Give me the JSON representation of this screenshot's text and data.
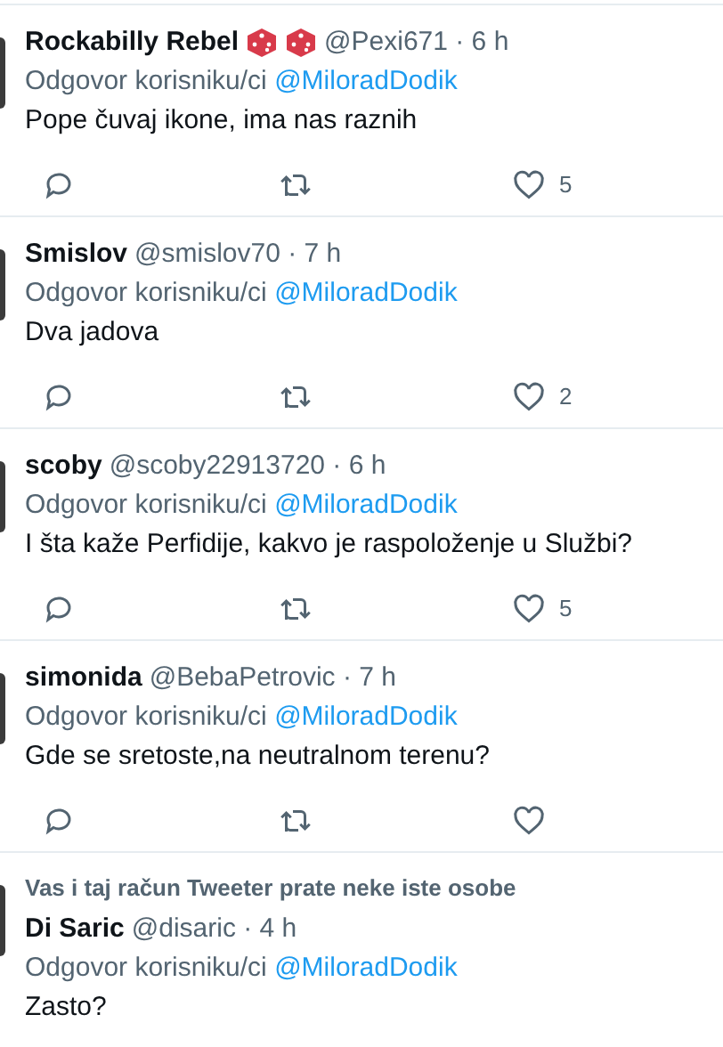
{
  "replies": [
    {
      "name": "Rockabilly Rebel",
      "name_icons": [
        {
          "kind": "dice"
        },
        {
          "kind": "dice"
        }
      ],
      "meta": "@Pexi671 · 6 h",
      "reply_prefix": "Odgovor korisniku/ci",
      "reply_to": "@MiloradDodik",
      "text": "Pope čuvaj ikone, ima nas raznih",
      "actions_shown": true,
      "likes": "5"
    },
    {
      "name": "Smislov",
      "meta": "@smislov70 · 7 h",
      "reply_prefix": "Odgovor korisniku/ci",
      "reply_to": "@MiloradDodik",
      "text": "Dva jadova",
      "actions_shown": true,
      "likes": "2"
    },
    {
      "name": "scoby",
      "meta": "@scoby22913720 · 6 h",
      "reply_prefix": "Odgovor korisniku/ci",
      "reply_to": "@MiloradDodik",
      "text": "I šta kaže Perfidije, kakvo je raspoloženje u Službi?",
      "actions_shown": true,
      "likes": "5"
    },
    {
      "name": "simonida",
      "meta": "@BebaPetrovic · 7 h",
      "reply_prefix": "Odgovor korisniku/ci",
      "reply_to": "@MiloradDodik",
      "text": "Gde se sretoste,na neutralnom terenu?",
      "actions_shown": true
    },
    {
      "context": "Vas i taj račun Tweeter prate neke iste osobe",
      "name": "Di Saric",
      "meta": "@disaric · 4 h",
      "reply_prefix": "Odgovor korisniku/ci",
      "reply_to": "@MiloradDodik",
      "text": "Zasto?",
      "actions_shown": false
    }
  ]
}
